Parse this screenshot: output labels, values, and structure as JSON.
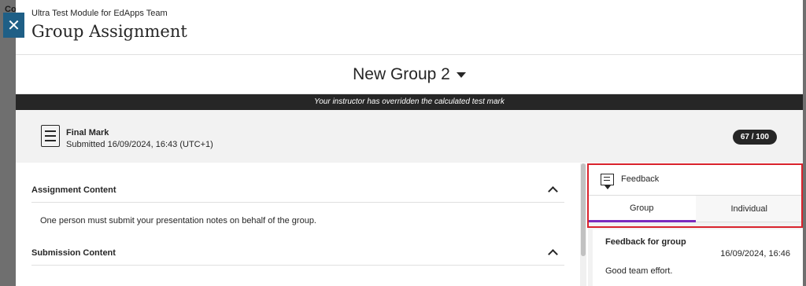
{
  "backdrop": {
    "peek_text": "Co"
  },
  "header": {
    "course_name": "Ultra Test Module for EdApps Team",
    "title": "Group Assignment",
    "close_icon": "close-icon"
  },
  "group_selector": {
    "value": "New Group 2"
  },
  "banner": {
    "text": "Your instructor has overridden the calculated test mark"
  },
  "mark": {
    "title": "Final Mark",
    "submitted": "Submitted 16/09/2024, 16:43 (UTC+1)",
    "score": "67 / 100"
  },
  "sections": [
    {
      "title": "Assignment Content",
      "body": "One person must submit your presentation notes on behalf of the group."
    },
    {
      "title": "Submission Content"
    }
  ],
  "feedback": {
    "title": "Feedback",
    "tabs": [
      {
        "label": "Group",
        "active": true
      },
      {
        "label": "Individual",
        "active": false
      }
    ],
    "card": {
      "title": "Feedback for group",
      "date": "16/09/2024, 16:46",
      "text": "Good team effort."
    }
  },
  "colors": {
    "accent": "#7b2bbd",
    "highlight": "#d9232c",
    "close_button": "#1f5f86",
    "banner": "#262626"
  }
}
